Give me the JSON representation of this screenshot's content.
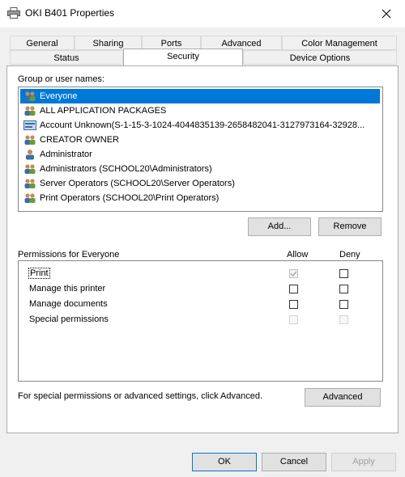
{
  "window": {
    "title": "OKI B401 Properties"
  },
  "tabs_row1": [
    "General",
    "Sharing",
    "Ports",
    "Advanced",
    "Color Management"
  ],
  "tabs_row2": [
    "Status",
    "Security",
    "Device Options"
  ],
  "security": {
    "group_label": "Group or user names:",
    "users": [
      {
        "name": "Everyone",
        "icon": "group-icon",
        "selected": true
      },
      {
        "name": "ALL APPLICATION PACKAGES",
        "icon": "group-icon",
        "selected": false
      },
      {
        "name": "Account Unknown(S-1-15-3-1024-4044835139-2658482041-3127973164-32928...",
        "icon": "unknown-account-icon",
        "selected": false
      },
      {
        "name": "CREATOR OWNER",
        "icon": "group-icon",
        "selected": false
      },
      {
        "name": "Administrator",
        "icon": "user-icon",
        "selected": false
      },
      {
        "name": "Administrators (SCHOOL20\\Administrators)",
        "icon": "group-icon",
        "selected": false
      },
      {
        "name": "Server Operators (SCHOOL20\\Server Operators)",
        "icon": "group-icon",
        "selected": false
      },
      {
        "name": "Print Operators (SCHOOL20\\Print Operators)",
        "icon": "group-icon",
        "selected": false
      }
    ],
    "add_label": "Add...",
    "remove_label": "Remove",
    "permissions_for": "Permissions for Everyone",
    "allow_label": "Allow",
    "deny_label": "Deny",
    "permissions": [
      {
        "name": "Print",
        "allow": "checked-disabled",
        "deny": "unchecked"
      },
      {
        "name": "Manage this printer",
        "allow": "unchecked",
        "deny": "unchecked"
      },
      {
        "name": "Manage documents",
        "allow": "unchecked",
        "deny": "unchecked"
      },
      {
        "name": "Special permissions",
        "allow": "disabled",
        "deny": "disabled"
      }
    ],
    "help_text": "For special permissions or advanced settings, click Advanced.",
    "advanced_label": "Advanced"
  },
  "footer": {
    "ok_label": "OK",
    "cancel_label": "Cancel",
    "apply_label": "Apply"
  },
  "colors": {
    "selection": "#0078d7",
    "dialog_bg": "#f0f0f0",
    "border": "#adadad"
  }
}
